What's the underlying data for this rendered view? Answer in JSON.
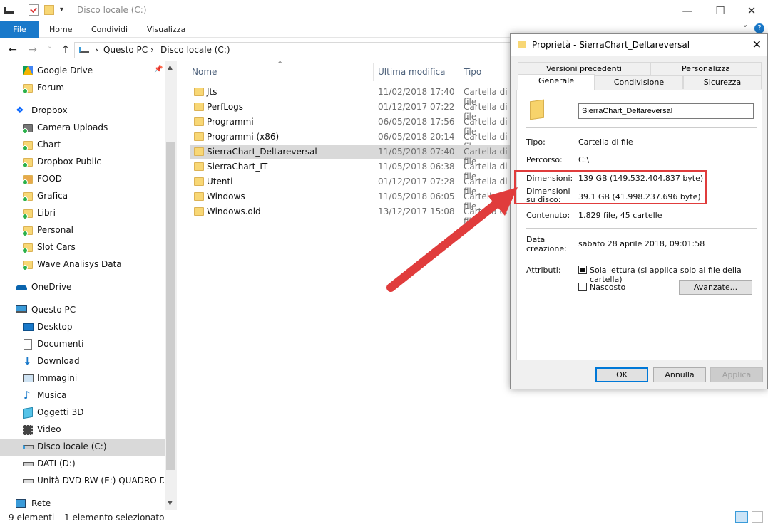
{
  "window": {
    "title": "Disco locale (C:)",
    "minimize_glyph": "—",
    "maximize_glyph": "☐",
    "close_glyph": "✕"
  },
  "ribbon": {
    "tabs": [
      "File",
      "Home",
      "Condividi",
      "Visualizza"
    ],
    "help_glyph": "?",
    "collapse_glyph": "˅"
  },
  "address": {
    "back_glyph": "←",
    "forward_glyph": "→",
    "recent_glyph": "˅",
    "up_glyph": "↑",
    "crumbs": [
      "Questo PC",
      "Disco locale (C:)"
    ],
    "separator": "›"
  },
  "nav": {
    "items": [
      {
        "label": "Google Drive",
        "icon": "google-drive-icon"
      },
      {
        "label": "Forum",
        "icon": "folder-icon"
      },
      {
        "label": "Dropbox",
        "icon": "dropbox-icon"
      },
      {
        "label": "Camera Uploads",
        "icon": "camera-icon"
      },
      {
        "label": "Chart",
        "icon": "folder-icon"
      },
      {
        "label": "Dropbox  Public",
        "icon": "folder-icon"
      },
      {
        "label": "FOOD",
        "icon": "folder-icon"
      },
      {
        "label": "Grafica",
        "icon": "folder-icon"
      },
      {
        "label": "Libri",
        "icon": "folder-icon"
      },
      {
        "label": "Personal",
        "icon": "folder-icon"
      },
      {
        "label": "Slot Cars",
        "icon": "folder-icon"
      },
      {
        "label": "Wave Analisys Data",
        "icon": "folder-icon"
      },
      {
        "label": "OneDrive",
        "icon": "onedrive-icon"
      },
      {
        "label": "Questo PC",
        "icon": "pc-icon"
      },
      {
        "label": "Desktop",
        "icon": "desktop-icon"
      },
      {
        "label": "Documenti",
        "icon": "documents-icon"
      },
      {
        "label": "Download",
        "icon": "download-icon"
      },
      {
        "label": "Immagini",
        "icon": "pictures-icon"
      },
      {
        "label": "Musica",
        "icon": "music-icon"
      },
      {
        "label": "Oggetti 3D",
        "icon": "3d-objects-icon"
      },
      {
        "label": "Video",
        "icon": "video-icon"
      },
      {
        "label": "Disco locale (C:)",
        "icon": "drive-icon"
      },
      {
        "label": "DATI (D:)",
        "icon": "drive-icon"
      },
      {
        "label": "Unità DVD RW (E:) QUADRO Driver",
        "icon": "dvd-icon"
      },
      {
        "label": "Rete",
        "icon": "network-icon"
      }
    ]
  },
  "filelist": {
    "headers": {
      "name": "Nome",
      "modified": "Ultima modifica",
      "type": "Tipo"
    },
    "sort_glyph": "^",
    "rows": [
      {
        "name": "Jts",
        "modified": "11/02/2018 17:40",
        "type": "Cartella di file"
      },
      {
        "name": "PerfLogs",
        "modified": "01/12/2017 07:22",
        "type": "Cartella di file"
      },
      {
        "name": "Programmi",
        "modified": "06/05/2018 17:56",
        "type": "Cartella di file"
      },
      {
        "name": "Programmi (x86)",
        "modified": "06/05/2018 20:14",
        "type": "Cartella di file"
      },
      {
        "name": "SierraChart_Deltareversal",
        "modified": "11/05/2018 07:40",
        "type": "Cartella di file"
      },
      {
        "name": "SierraChart_IT",
        "modified": "11/05/2018 06:38",
        "type": "Cartella di file"
      },
      {
        "name": "Utenti",
        "modified": "01/12/2017 07:28",
        "type": "Cartella di file"
      },
      {
        "name": "Windows",
        "modified": "11/05/2018 06:05",
        "type": "Cartella di file"
      },
      {
        "name": "Windows.old",
        "modified": "13/12/2017 15:08",
        "type": "Cartella di file"
      }
    ]
  },
  "status": {
    "count": "9 elementi",
    "selected": "1 elemento selezionato"
  },
  "dialog": {
    "title": "Proprietà - SierraChart_Deltareversal",
    "close_glyph": "✕",
    "tabs_row1": [
      "Versioni precedenti",
      "Personalizza"
    ],
    "tabs_row2": [
      "Generale",
      "Condivisione",
      "Sicurezza"
    ],
    "name_value": "SierraChart_Deltareversal",
    "fields": {
      "tipo_label": "Tipo:",
      "tipo_value": "Cartella di file",
      "percorso_label": "Percorso:",
      "percorso_value": "C:\\",
      "dimensioni_label": "Dimensioni:",
      "dimensioni_value": "139 GB (149.532.404.837 byte)",
      "dimensioni_disco_label": "Dimensioni su disco:",
      "dimensioni_disco_value": "39.1 GB (41.998.237.696 byte)",
      "contenuto_label": "Contenuto:",
      "contenuto_value": "1.829 file, 45 cartelle",
      "data_label": "Data creazione:",
      "data_value": "sabato 28 aprile 2018, 09:01:58",
      "attributi_label": "Attributi:"
    },
    "attributes": {
      "readonly_label": "Sola lettura (si applica solo ai file della cartella)",
      "hidden_label": "Nascosto",
      "advanced_button": "Avanzate..."
    },
    "buttons": {
      "ok": "OK",
      "cancel": "Annulla",
      "apply": "Applica"
    }
  },
  "colors": {
    "accent": "#1979ca",
    "selection": "#d9d9d9",
    "annotation": "#e03c3c",
    "folder": "#f7d36b"
  }
}
